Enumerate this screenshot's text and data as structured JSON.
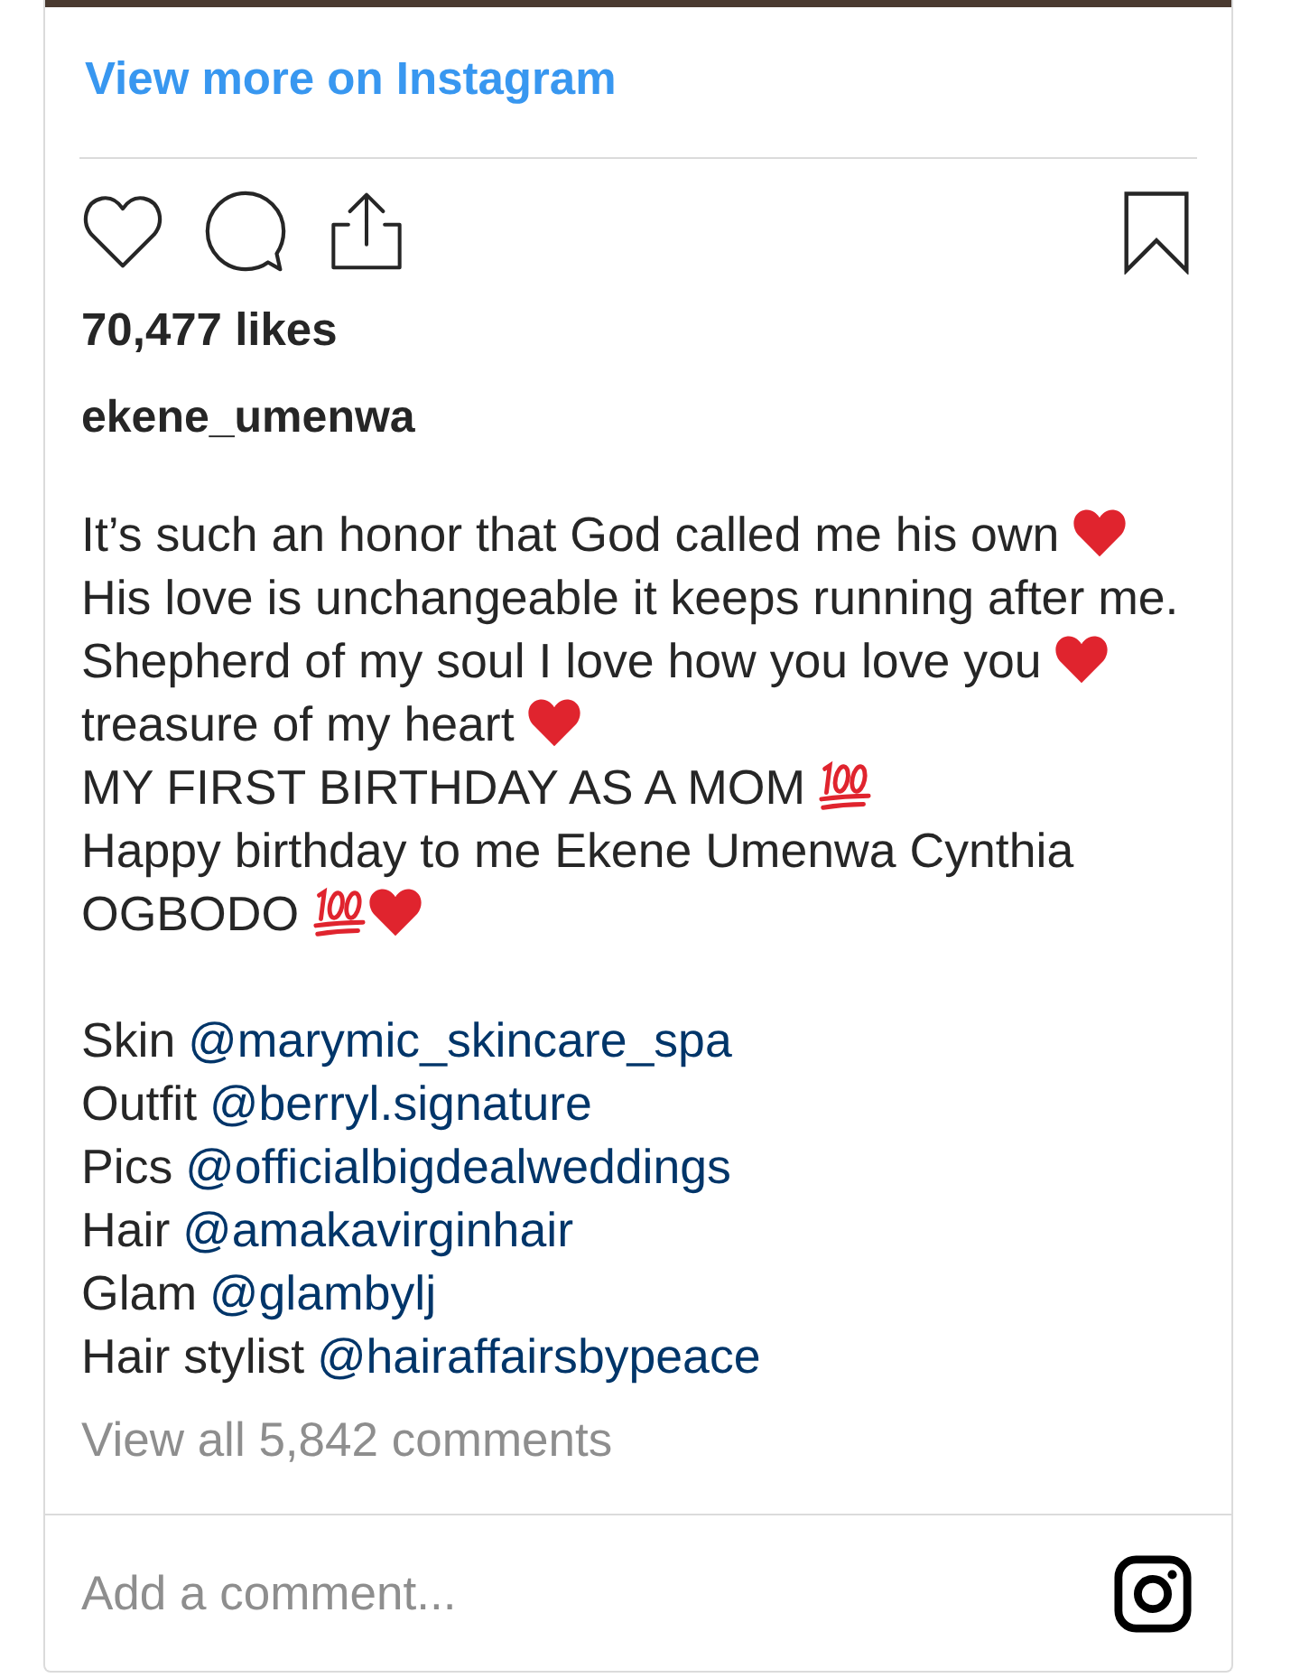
{
  "link": {
    "label": "View more on Instagram"
  },
  "actions": {
    "liked": false,
    "saved": false
  },
  "likes": "70,477 likes",
  "username": "ekene_umenwa",
  "caption": [
    {
      "text": "It’s such an honor that God called me his own",
      "emoji": [
        {
          "kind": "heart"
        }
      ]
    },
    {
      "text": "His love is unchangeable it keeps running after me."
    },
    {
      "text": "Shepherd of my soul I love how you love you",
      "emoji": [
        {
          "kind": "heart"
        }
      ]
    },
    {
      "text": "treasure of my heart",
      "emoji": [
        {
          "kind": "heart"
        }
      ]
    },
    {
      "text": "MY FIRST BIRTHDAY AS A MOM",
      "emoji": [
        {
          "kind": "hundred"
        }
      ]
    },
    {
      "text": "Happy birthday to me Ekene Umenwa Cynthia"
    },
    {
      "text": "OGBODO",
      "emoji": [
        {
          "kind": "hundred"
        },
        {
          "kind": "heart"
        }
      ]
    }
  ],
  "credits": [
    {
      "label": "Skin",
      "handle": "@marymic_skincare_spa"
    },
    {
      "label": "Outfit",
      "handle": "@berryl.signature"
    },
    {
      "label": "Pics",
      "handle": "@officialbigdealweddings"
    },
    {
      "label": "Hair",
      "handle": "@amakavirginhair"
    },
    {
      "label": "Glam",
      "handle": "@glambylj"
    },
    {
      "label": "Hair stylist",
      "handle": "@hairaffairsbypeace"
    }
  ],
  "comments_link": "View all 5,842 comments",
  "comment_field": {
    "placeholder": "Add a comment..."
  }
}
